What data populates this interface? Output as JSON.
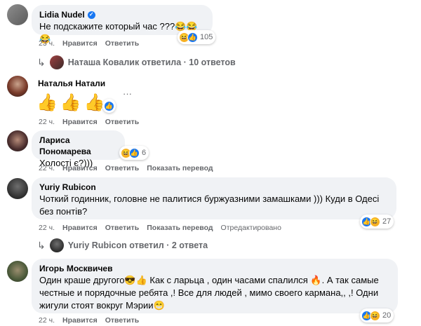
{
  "comments": [
    {
      "author": "Lidia Nudel",
      "text": "Не подскажите который час ???😂😂😂",
      "time": "23 ч.",
      "like": "Нравится",
      "reply": "Ответить",
      "reactions": "105"
    },
    {
      "author": "Наталья Натали",
      "text": "👍👍👍",
      "time": "22 ч.",
      "like": "Нравится",
      "reply": "Ответить",
      "more": "···"
    },
    {
      "author": "Лариса Пономарева",
      "text": "Холості є?)))",
      "time": "22 ч.",
      "like": "Нравится",
      "reply": "Ответить",
      "translate": "Показать перевод",
      "reactions": "6"
    },
    {
      "author": "Yuriy Rubicon",
      "text_line1": "Чоткий годинник, головне не палитися буржуазними замашками ))) Куди в Одесі",
      "text_line2": "без понтів?",
      "time": "22 ч.",
      "like": "Нравится",
      "reply": "Ответить",
      "translate": "Показать перевод",
      "edited": "Отредактировано",
      "reactions": "27"
    },
    {
      "author": "Игорь Москвичев",
      "text_line1": "Один краше другого😎👍 Как с ларьца , один часами спалился 🔥. А так самые",
      "text_line2": "честные и порядочные ребята ,! Все для людей , мимо своего кармана,, ,! Одни",
      "text_line3": "жигули стоят вокруг Мэрии😁",
      "time": "22 ч.",
      "like": "Нравится",
      "reply": "Ответить",
      "reactions": "20"
    }
  ],
  "reply_threads": [
    {
      "text": "Наташа Ковалик ответила · 10 ответов"
    },
    {
      "text": "Yuriy Rubicon ответил · 2 ответа"
    }
  ]
}
